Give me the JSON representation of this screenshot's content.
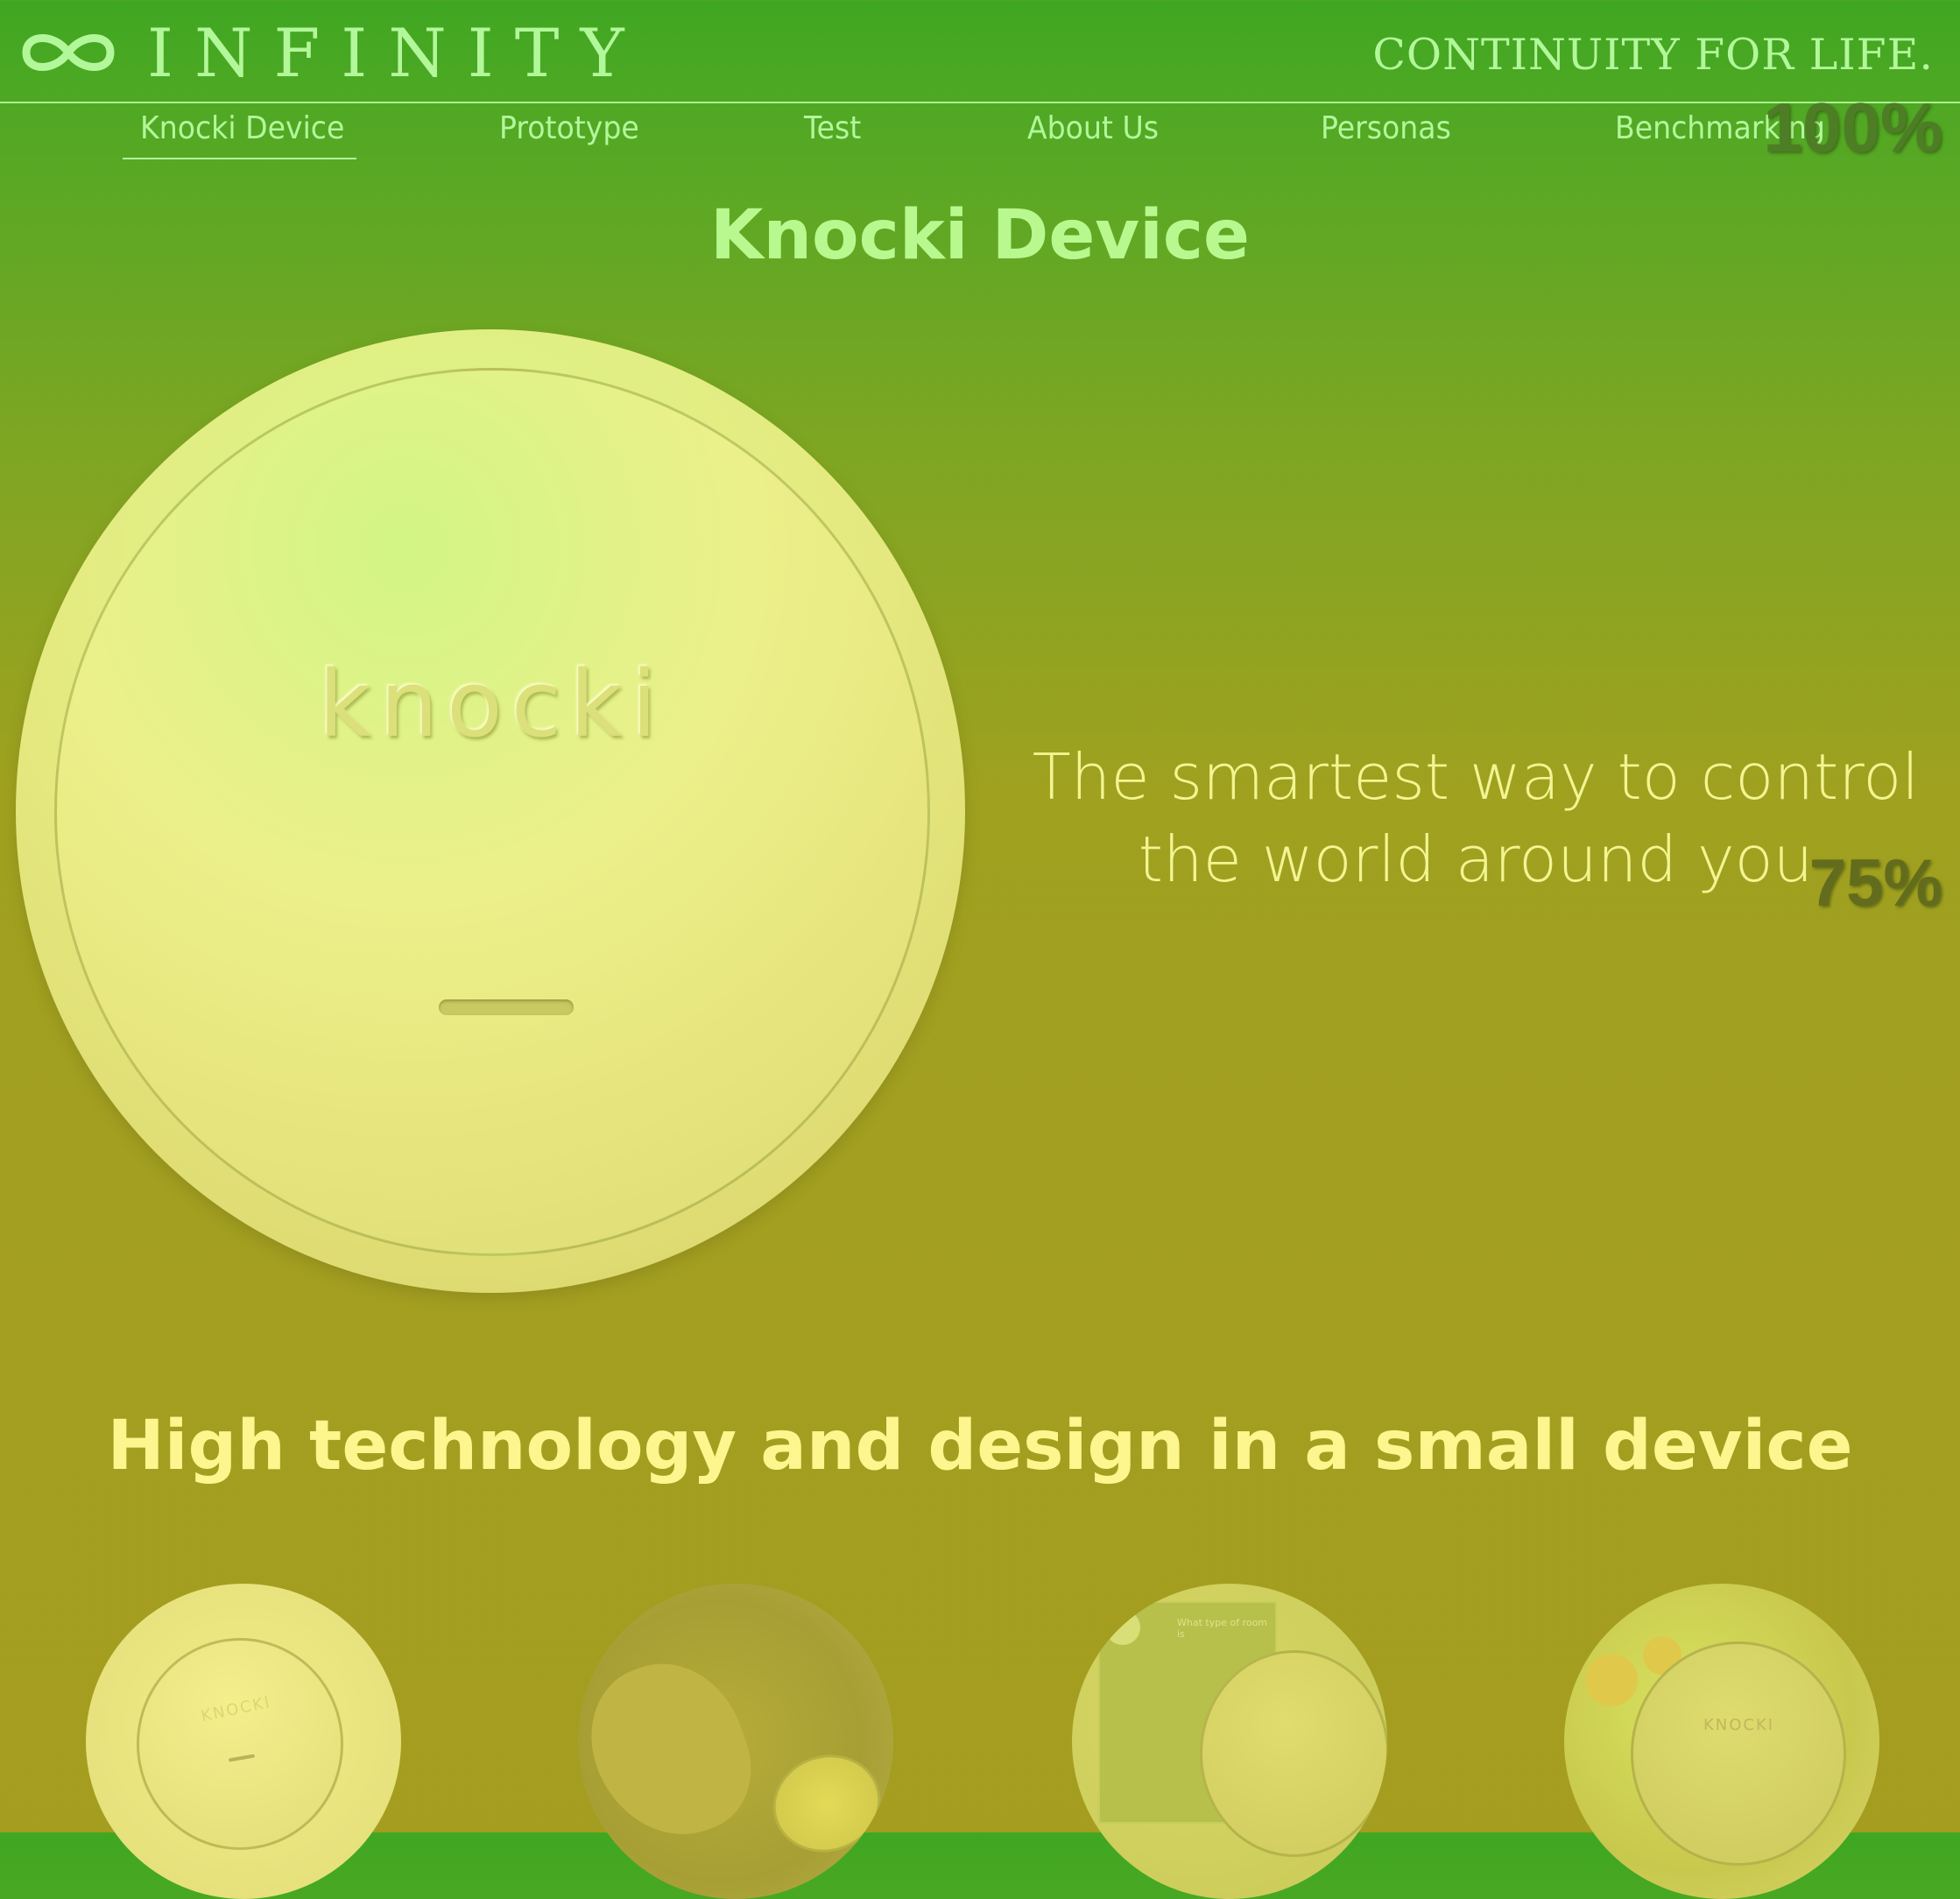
{
  "brand": {
    "name": "INFINITY",
    "tagline": "CONTINUITY FOR LIFE."
  },
  "nav": {
    "items": [
      {
        "label": "Knocki Device",
        "active": true
      },
      {
        "label": "Prototype"
      },
      {
        "label": "Test"
      },
      {
        "label": "About Us"
      },
      {
        "label": "Personas"
      },
      {
        "label": "Benchmarking"
      }
    ]
  },
  "overlay": {
    "top_percent": "100%",
    "mid_percent": "75%"
  },
  "hero": {
    "title": "Knocki Device",
    "device_brand": "knocki",
    "tagline": "The smartest way to control the world around you"
  },
  "features": {
    "title": "High technology and design in a small device",
    "thumbs": [
      {
        "name": "device-top-view",
        "mini_brand": "KNOCKI"
      },
      {
        "name": "hand-knocking"
      },
      {
        "name": "room-panel",
        "panel_text": "What type of room is"
      },
      {
        "name": "hands-holding-device",
        "mini_brand": "KNOCKI"
      }
    ]
  },
  "colors": {
    "nav_text": "#b3f79b",
    "title_green": "#b9f88f",
    "tagline_yellow": "#f2f591",
    "section_yellow": "#fdf58e"
  }
}
